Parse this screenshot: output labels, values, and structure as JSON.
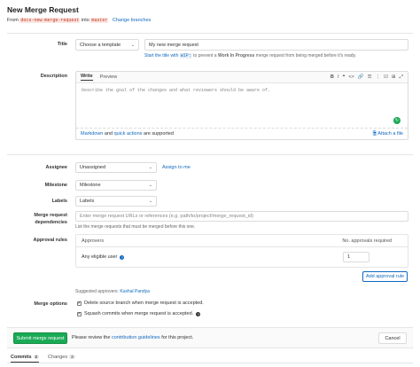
{
  "page": {
    "title": "New Merge Request",
    "from_prefix": "From",
    "source_branch": "docs-new-merge-request",
    "into_text": "into",
    "target_branch": "master",
    "change_branches": "Change branches"
  },
  "title_section": {
    "label": "Title",
    "template_dropdown": "Choose a template",
    "title_value": "My new merge request",
    "hint_link": "Start the title with",
    "hint_code": "WIP:",
    "hint_mid": "to prevent a",
    "hint_bold": "Work In Progress",
    "hint_end": "merge request from being merged before it's ready."
  },
  "description": {
    "label": "Description",
    "tab_write": "Write",
    "tab_preview": "Preview",
    "toolbar_icons": [
      "B",
      "I",
      "❝",
      "<>",
      "🔗",
      "☰",
      "⋮",
      "☑",
      "⊞",
      "⤢"
    ],
    "placeholder": "Describe the goal of the changes and what reviewers should be aware of.",
    "footer_markdown": "Markdown",
    "footer_and": "and",
    "footer_quick": "quick actions",
    "footer_supported": "are supported",
    "attach": "Attach a file"
  },
  "assignee": {
    "label": "Assignee",
    "value": "Unassigned",
    "link": "Assign to me"
  },
  "milestone": {
    "label": "Milestone",
    "value": "Milestone"
  },
  "labels": {
    "label": "Labels",
    "value": "Labels"
  },
  "dependencies": {
    "label_line1": "Merge request",
    "label_line2": "dependencies",
    "placeholder": "Enter merge request URLs or references (e.g. path/to/project!merge_request_id)",
    "hint": "List the merge requests that must be merged before this one."
  },
  "approvals": {
    "label": "Approval rules",
    "col_approvers": "Approvers",
    "col_required": "No. approvals required",
    "row_name": "Any eligible user",
    "row_value": "1",
    "add_rule": "Add approval rule",
    "suggested_prefix": "Suggested approvers:",
    "suggested_name": "Kushal Pandya"
  },
  "merge_options": {
    "label": "Merge options",
    "option1": "Delete source branch when merge request is accepted.",
    "option2": "Squash commits when merge request is accepted."
  },
  "footer": {
    "submit": "Submit merge request",
    "note_prefix": "Please review the",
    "note_link": "contribution guidelines",
    "note_suffix": "for this project.",
    "cancel": "Cancel"
  },
  "bottom_tabs": [
    {
      "label": "Commits",
      "count": "2"
    },
    {
      "label": "Changes",
      "count": "3"
    }
  ],
  "colors": {
    "accent_blue": "#1068bf",
    "submit_green": "#1aaa55",
    "code_red": "#c0341d"
  }
}
